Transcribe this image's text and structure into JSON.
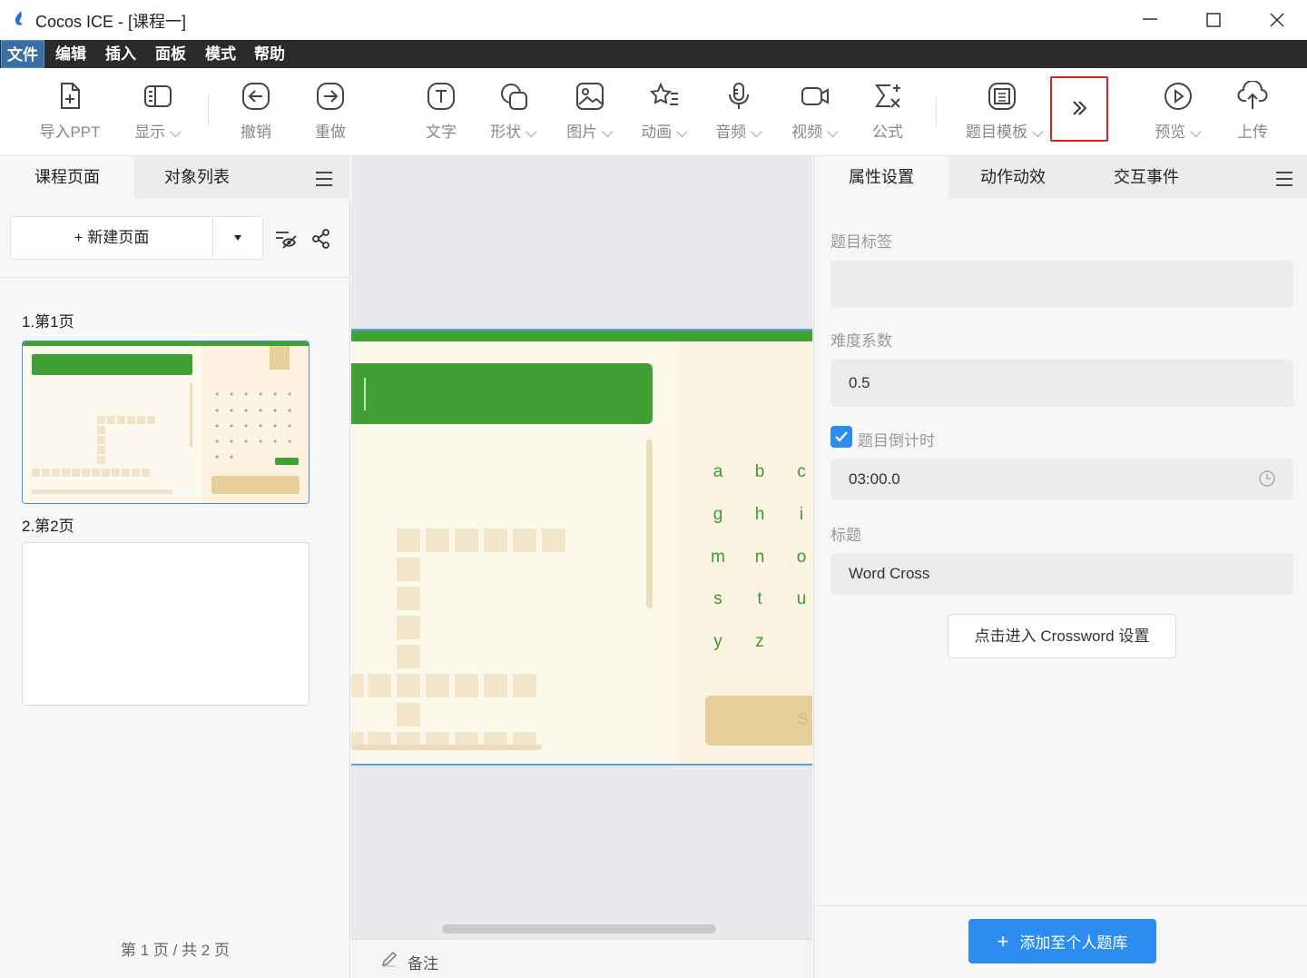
{
  "window": {
    "title": "Cocos ICE - [课程一]"
  },
  "menu": [
    "文件",
    "编辑",
    "插入",
    "面板",
    "模式",
    "帮助"
  ],
  "toolbar": {
    "import_ppt": "导入PPT",
    "display": "显示",
    "undo": "撤销",
    "redo": "重做",
    "text": "文字",
    "shape": "形状",
    "image": "图片",
    "animation": "动画",
    "audio": "音频",
    "video": "视频",
    "formula": "公式",
    "question_template": "题目模板",
    "preview": "预览",
    "upload": "上传"
  },
  "left_panel": {
    "tabs": [
      "课程页面",
      "对象列表"
    ],
    "new_page": "+ 新建页面",
    "pages": [
      "1.第1页",
      "2.第2页"
    ],
    "footer": "第 1 页 / 共 2 页"
  },
  "slide": {
    "letters": [
      "a",
      "b",
      "c",
      "g",
      "h",
      "i",
      "m",
      "n",
      "o",
      "s",
      "t",
      "u",
      "y",
      "z"
    ]
  },
  "notes": {
    "label": "备注"
  },
  "right_panel": {
    "tabs": [
      "属性设置",
      "动作动效",
      "交互事件"
    ],
    "question_tag_label": "题目标签",
    "question_tag_value": "",
    "difficulty_label": "难度系数",
    "difficulty_value": "0.5",
    "countdown_label": "题目倒计时",
    "countdown_checked": true,
    "countdown_value": "03:00.0",
    "title_label": "标题",
    "title_value": "Word Cross",
    "crossword_button": "点击进入 Crossword 设置",
    "add_bank_button": "添加至个人题库"
  },
  "colors": {
    "accent": "#2d8cf0",
    "highlight": "#e52020",
    "slide_green": "#3fa134"
  }
}
